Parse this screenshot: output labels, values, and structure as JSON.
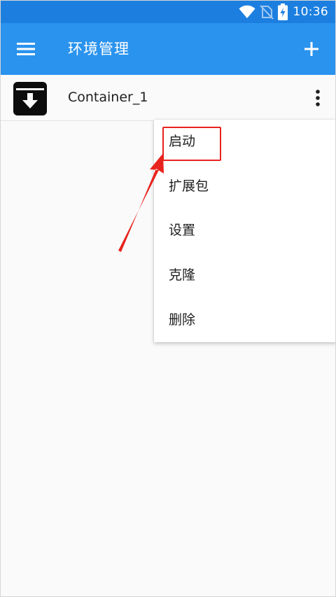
{
  "status_bar": {
    "time": "10:36",
    "icons": [
      "wifi-icon",
      "no-sim-icon",
      "battery-charging-icon"
    ]
  },
  "app_bar": {
    "title": "环境管理",
    "menu_icon": "hamburger-menu-icon",
    "add_icon": "add-icon",
    "background_color": "#2a93ee"
  },
  "containers": [
    {
      "name": "Container_1",
      "icon": "archive-download-icon",
      "more_icon": "more-vertical-icon"
    }
  ],
  "popup_menu": {
    "items": [
      {
        "label": "启动"
      },
      {
        "label": "扩展包"
      },
      {
        "label": "设置"
      },
      {
        "label": "克隆"
      },
      {
        "label": "删除"
      }
    ]
  },
  "annotation": {
    "highlight_color": "#e8231e"
  }
}
